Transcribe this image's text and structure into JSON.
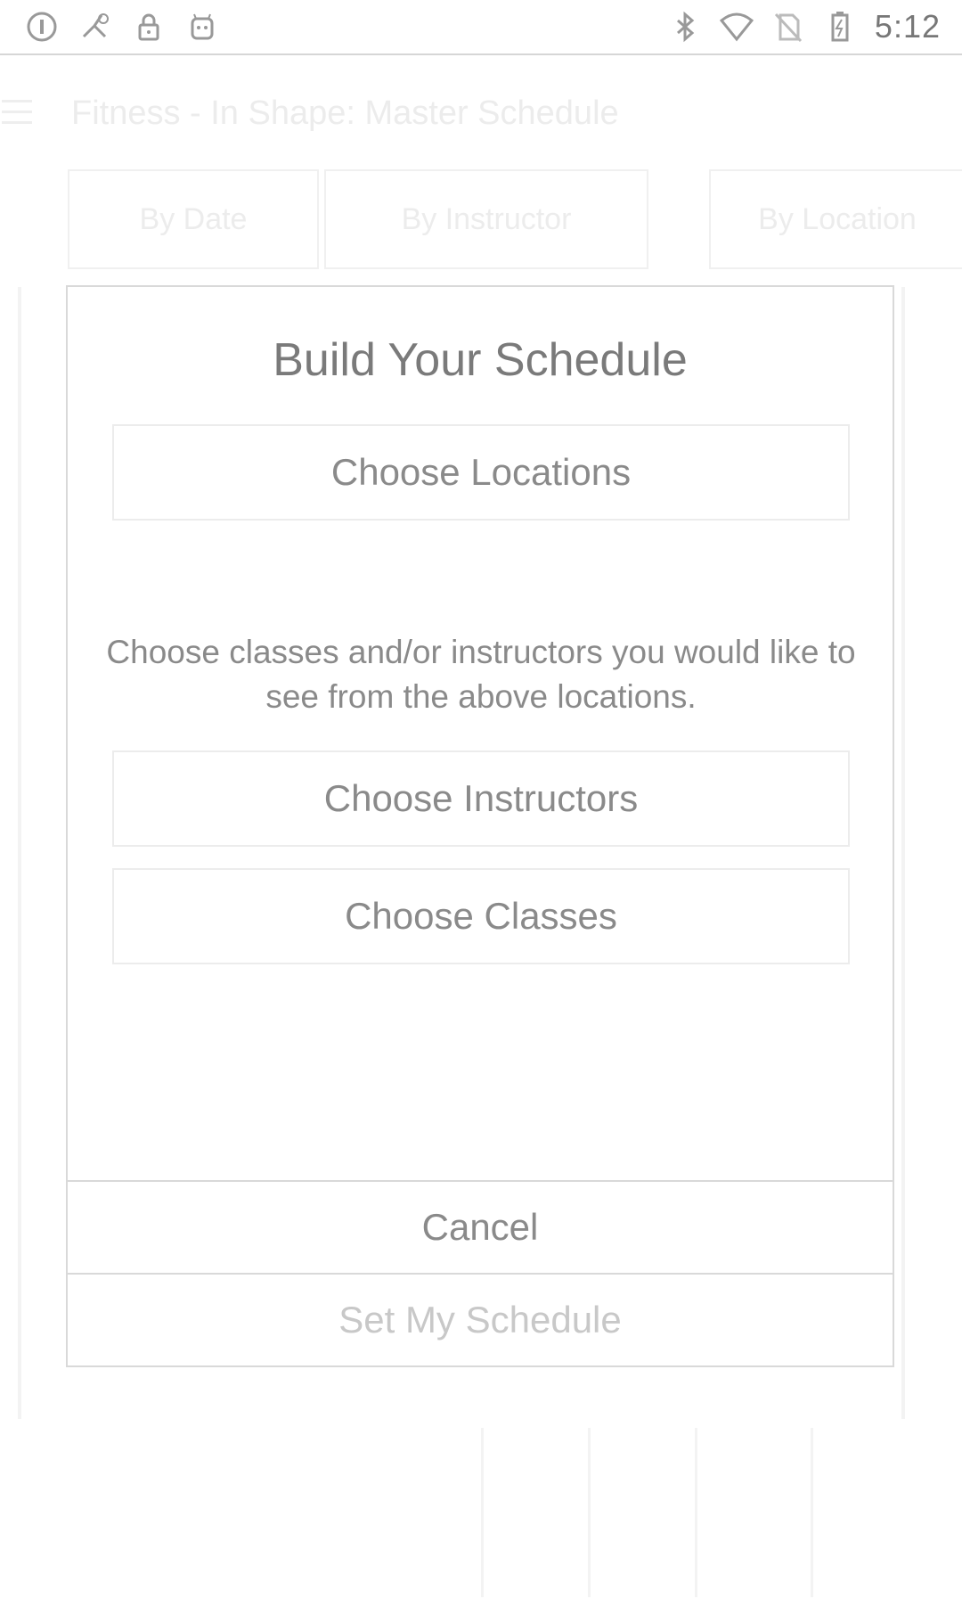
{
  "status_bar": {
    "time": "5:12",
    "left_icons": [
      "circle-info-icon",
      "fake-gps-icon",
      "lock-icon",
      "android-icon"
    ],
    "right_icons": [
      "bluetooth-icon",
      "wifi-icon",
      "no-sim-icon",
      "battery-charging-icon"
    ]
  },
  "background": {
    "title": "Fitness - In Shape: Master Schedule",
    "tabs": [
      "By Date",
      "By Instructor",
      "By Location"
    ]
  },
  "dialog": {
    "title": "Build Your Schedule",
    "choose_locations_label": "Choose Locations",
    "help_text": "Choose classes and/or instructors you would like to see from the above locations.",
    "choose_instructors_label": "Choose Instructors",
    "choose_classes_label": "Choose Classes",
    "cancel_label": "Cancel",
    "set_schedule_label": "Set My Schedule"
  }
}
